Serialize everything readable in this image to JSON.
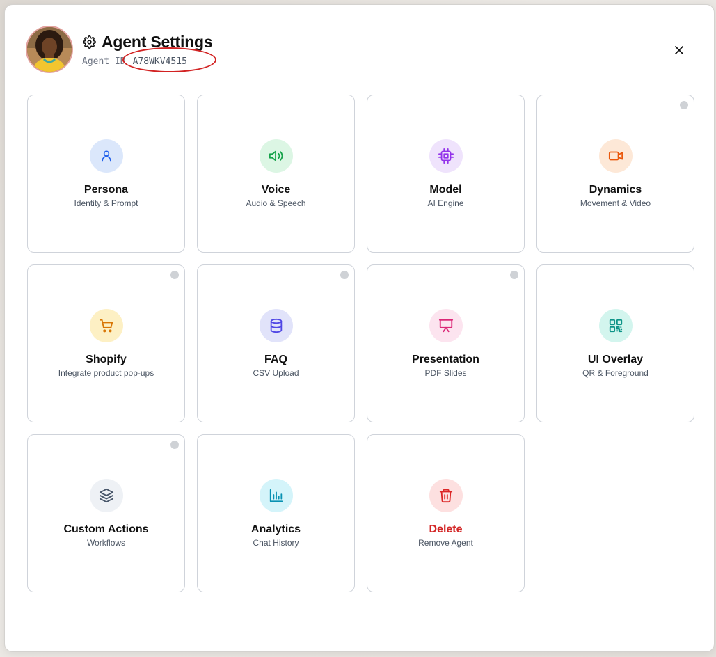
{
  "header": {
    "title": "Agent Settings",
    "agent_id_label": "Agent ID",
    "agent_id_value": "A78WKV4515"
  },
  "colors": {
    "delete_accent": "#d32626",
    "annotation_oval": "#d22222",
    "status_dot": "#cfd2d6"
  },
  "cards": [
    {
      "label": "Persona",
      "sublabel": "Identity & Prompt",
      "icon": "user-icon",
      "icon_color": "#2563eb",
      "bg_color": "#dbe7fb",
      "status_dot": false
    },
    {
      "label": "Voice",
      "sublabel": "Audio & Speech",
      "icon": "speaker-icon",
      "icon_color": "#16a34a",
      "bg_color": "#dcf6e4",
      "status_dot": false
    },
    {
      "label": "Model",
      "sublabel": "AI Engine",
      "icon": "cpu-icon",
      "icon_color": "#9333ea",
      "bg_color": "#efe3fc",
      "status_dot": false
    },
    {
      "label": "Dynamics",
      "sublabel": "Movement & Video",
      "icon": "video-camera-icon",
      "icon_color": "#ea580c",
      "bg_color": "#fde8d7",
      "status_dot": true
    },
    {
      "label": "Shopify",
      "sublabel": "Integrate product pop-ups",
      "icon": "shopping-cart-icon",
      "icon_color": "#d97706",
      "bg_color": "#fdf0c4",
      "status_dot": true
    },
    {
      "label": "FAQ",
      "sublabel": "CSV Upload",
      "icon": "database-icon",
      "icon_color": "#4f46e5",
      "bg_color": "#e1e3fa",
      "status_dot": true
    },
    {
      "label": "Presentation",
      "sublabel": "PDF Slides",
      "icon": "presentation-icon",
      "icon_color": "#db2777",
      "bg_color": "#fce4ef",
      "status_dot": true
    },
    {
      "label": "UI Overlay",
      "sublabel": "QR & Foreground",
      "icon": "qr-code-icon",
      "icon_color": "#0d9488",
      "bg_color": "#d3f5ee",
      "status_dot": false
    },
    {
      "label": "Custom Actions",
      "sublabel": "Workflows",
      "icon": "layers-icon",
      "icon_color": "#475569",
      "bg_color": "#eef1f5",
      "status_dot": true
    },
    {
      "label": "Analytics",
      "sublabel": "Chat History",
      "icon": "bar-chart-icon",
      "icon_color": "#0891b2",
      "bg_color": "#d4f4fa",
      "status_dot": false
    },
    {
      "label": "Delete",
      "sublabel": "Remove Agent",
      "icon": "trash-icon",
      "icon_color": "#dc2626",
      "bg_color": "#fde0e0",
      "status_dot": false
    }
  ]
}
